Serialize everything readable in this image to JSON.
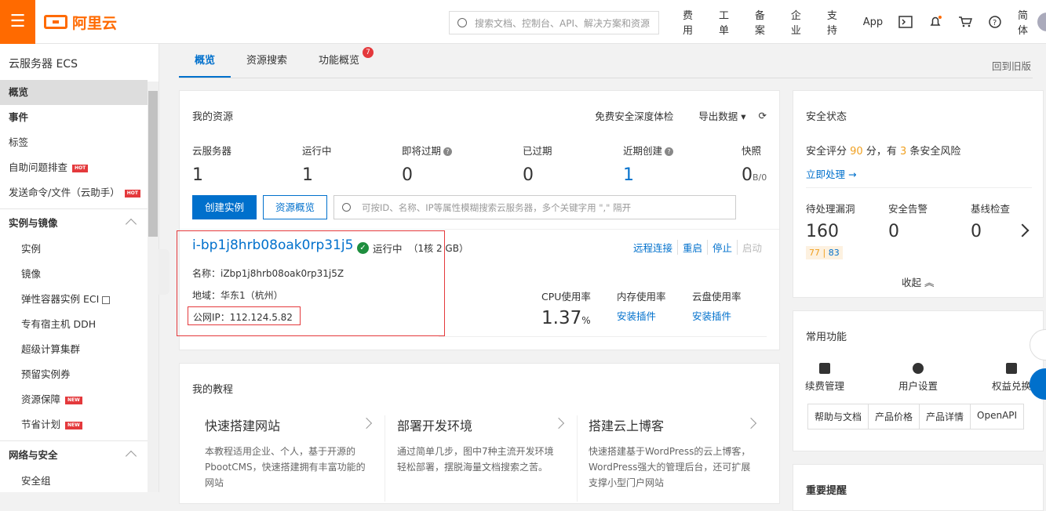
{
  "topbar": {
    "logo": "阿里云",
    "search_placeholder": "搜索文档、控制台、API、解决方案和资源",
    "nav": [
      "费用",
      "工单",
      "备案",
      "企业",
      "支持",
      "App"
    ],
    "lang": "简体"
  },
  "sidebar": {
    "title": "云服务器 ECS",
    "top_items": [
      {
        "label": "概览"
      },
      {
        "label": "事件"
      },
      {
        "label": "标签"
      },
      {
        "label": "自助问题排查",
        "badge": "HOT"
      },
      {
        "label": "发送命令/文件（云助手）",
        "badge": "HOT"
      }
    ],
    "group1": "实例与镜像",
    "group1_items": [
      {
        "label": "实例"
      },
      {
        "label": "镜像"
      },
      {
        "label": "弹性容器实例 ECI"
      },
      {
        "label": "专有宿主机 DDH"
      },
      {
        "label": "超级计算集群"
      },
      {
        "label": "预留实例券"
      },
      {
        "label": "资源保障",
        "badge": "NEW"
      },
      {
        "label": "节省计划",
        "badge": "NEW"
      }
    ],
    "group2": "网络与安全",
    "group2_items": [
      {
        "label": "安全组"
      }
    ]
  },
  "tabs": [
    {
      "label": "概览"
    },
    {
      "label": "资源搜索"
    },
    {
      "label": "功能概览",
      "badge": "7"
    }
  ],
  "old_version": "回到旧版",
  "resources": {
    "title": "我的资源",
    "trial": "免费安全深度体检",
    "export": "导出数据",
    "stats": [
      {
        "label": "云服务器",
        "value": "1"
      },
      {
        "label": "运行中",
        "value": "1"
      },
      {
        "label": "即将过期",
        "value": "0"
      },
      {
        "label": "已过期",
        "value": "0"
      },
      {
        "label": "近期创建",
        "value": "1"
      },
      {
        "label": "快照",
        "value": "0",
        "unit": "B/0"
      }
    ],
    "create_btn": "创建实例",
    "overview_btn": "资源概览",
    "search_placeholder": "可按ID、名称、IP等属性模糊搜索云服务器，多个关键字用 \",\" 隔开",
    "instance": {
      "id": "i-bp1j8hrb08oak0rp31j5",
      "status": "运行中",
      "spec": "（1核 2 GB）",
      "name_line": "名称：iZbp1j8hrb08oak0rp31j5Z",
      "region_line": "地域：华东1（杭州）",
      "ip_line": "公网IP：112.124.5.82",
      "ops": [
        "远程连接",
        "重启",
        "停止",
        "启动"
      ],
      "cpu_label": "CPU使用率",
      "cpu_value": "1.37",
      "cpu_unit": "%",
      "mem_label": "内存使用率",
      "mem_link": "安装插件",
      "disk_label": "云盘使用率",
      "disk_link": "安装插件"
    }
  },
  "tutorials": {
    "title": "我的教程",
    "cards": [
      {
        "title": "快速搭建网站",
        "desc": "本教程适用企业、个人，基于开源的PbootCMS，快速搭建拥有丰富功能的网站"
      },
      {
        "title": "部署开发环境",
        "desc": "通过简单几步，图中7种主流开发环境轻松部署，摆脱海量文档搜索之苦。"
      },
      {
        "title": "搭建云上博客",
        "desc": "快速搭建基于WordPress的云上博客，WordPress强大的管理后台，还可扩展支撑小型门户网站"
      }
    ]
  },
  "security": {
    "title": "安全状态",
    "score_prefix": "安全评分",
    "score": "90",
    "score_mid": "分，有",
    "risk_count": "3",
    "score_suffix": "条安全风险",
    "action": "立即处理 →",
    "items": [
      {
        "label": "待处理漏洞",
        "value": "160",
        "sub_a": "77",
        "sub_b": "83"
      },
      {
        "label": "安全告警",
        "value": "0"
      },
      {
        "label": "基线检查",
        "value": "0"
      }
    ],
    "fold": "收起"
  },
  "common": {
    "title": "常用功能",
    "functions": [
      "续费管理",
      "用户设置",
      "权益兑换"
    ],
    "tags": [
      "帮助与文档",
      "产品价格",
      "产品详情",
      "OpenAPI"
    ]
  },
  "notice": {
    "title": "重要提醒"
  }
}
